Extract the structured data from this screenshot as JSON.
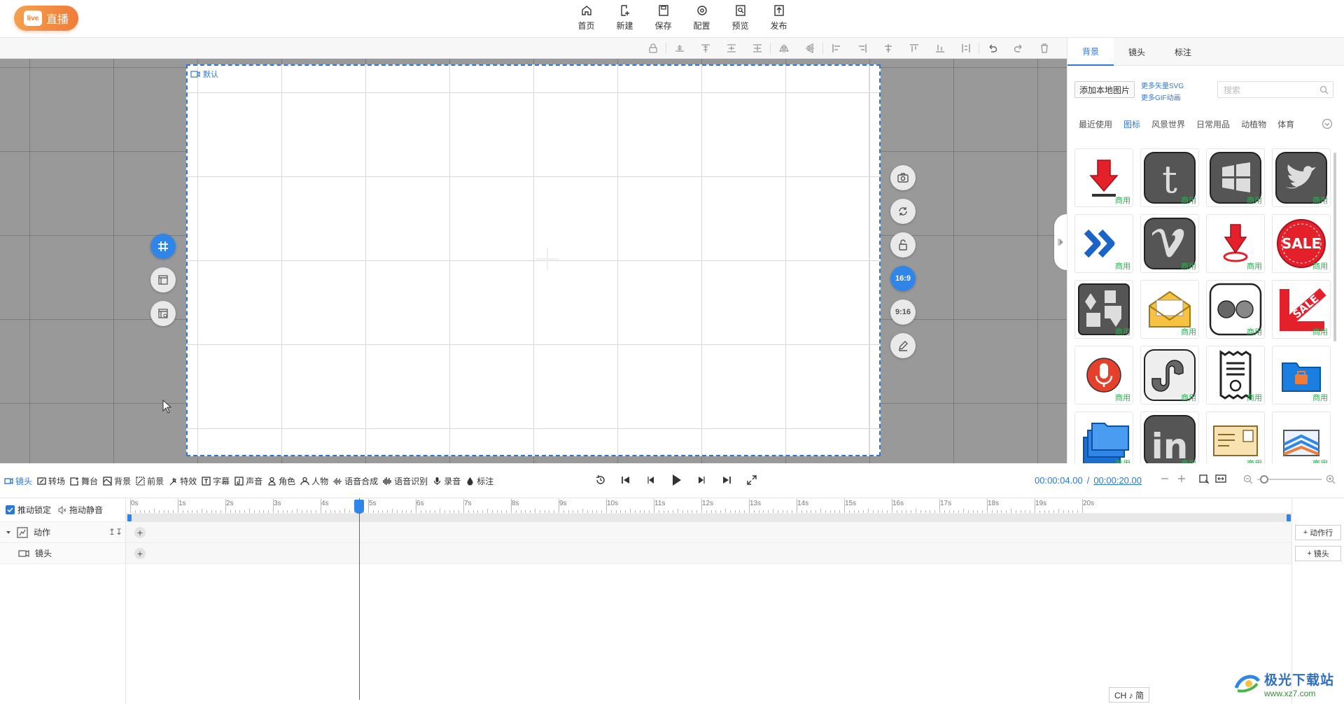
{
  "topbar": {
    "live_label": "直播",
    "live_logo": "live",
    "menu": [
      {
        "label": "首页",
        "icon": "home-icon"
      },
      {
        "label": "新建",
        "icon": "new-file-icon"
      },
      {
        "label": "保存",
        "icon": "save-icon"
      },
      {
        "label": "配置",
        "icon": "settings-icon"
      },
      {
        "label": "预览",
        "icon": "preview-icon"
      },
      {
        "label": "发布",
        "icon": "publish-icon"
      }
    ]
  },
  "stage": {
    "label": "默认"
  },
  "side_buttons_right": [
    {
      "name": "screenshot-icon"
    },
    {
      "name": "rotate-icon"
    },
    {
      "name": "unlock-icon"
    },
    {
      "label": "16:9",
      "active": true
    },
    {
      "label": "9:16",
      "active": false
    },
    {
      "name": "edit-icon"
    }
  ],
  "right_panel": {
    "tabs": [
      "背景",
      "镜头",
      "标注"
    ],
    "active_tab": "背景",
    "add_local": "添加本地图片",
    "more_svg": "更多矢量SVG",
    "more_gif": "更多GIF动画",
    "search_placeholder": "搜索",
    "categories": [
      "最近使用",
      "图标",
      "风景世界",
      "日常用品",
      "动植物",
      "体育"
    ],
    "active_category": "图标",
    "tag": "商用",
    "icons": [
      "download-arrow-icon",
      "tumblr-icon",
      "windows-icon",
      "twitter-icon",
      "fast-forward-icon",
      "vimeo-icon",
      "pin-icon",
      "sale-badge-icon",
      "construction-icon",
      "mail-icon",
      "flickr-icon",
      "sale-tag-icon",
      "microphone-icon",
      "stumbleupon-icon",
      "receipt-icon",
      "briefcase-icon",
      "folders-icon",
      "linkedin-icon",
      "postcard-icon",
      "layers-icon"
    ]
  },
  "timeline": {
    "tools": [
      "镜头",
      "转场",
      "舞台",
      "背景",
      "前景",
      "特效",
      "字幕",
      "声音",
      "角色",
      "人物",
      "语音合成",
      "语音识别",
      "录音",
      "标注"
    ],
    "current_time": "00:00:04.00",
    "separator": "/",
    "total_time": "00:00:20.00",
    "option_lock": "推动锁定",
    "option_mute": "拖动静音",
    "tracks": [
      "动作",
      "镜头"
    ],
    "ruler": [
      "0s",
      "1s",
      "2s",
      "3s",
      "4s",
      "5s",
      "6s",
      "7s",
      "8s",
      "9s",
      "10s",
      "11s",
      "12s",
      "13s",
      "14s",
      "15s",
      "16s",
      "17s",
      "18s",
      "19s",
      "20s"
    ],
    "add_action_row": "动作行",
    "add_camera": "镜头"
  },
  "ime": "CH ♪ 简",
  "watermark": {
    "title": "极光下载站",
    "url": "www.xz7.com"
  },
  "colors": {
    "accent": "#2f78d0",
    "live_orange": "#f07c3a",
    "playhead": "#e8302e",
    "commercial_tag": "#3aa757"
  }
}
